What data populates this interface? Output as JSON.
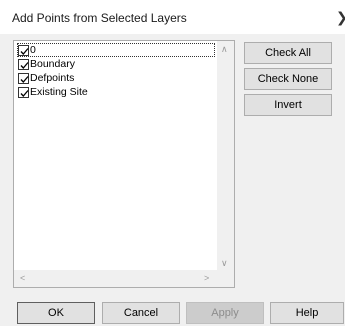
{
  "window": {
    "title": "Add Points from Selected Layers",
    "close_glyph": "❯"
  },
  "layer_list": {
    "items": [
      {
        "label": "0",
        "checked": true
      },
      {
        "label": "Boundary",
        "checked": true
      },
      {
        "label": "Defpoints",
        "checked": true
      },
      {
        "label": "Existing Site",
        "checked": true
      }
    ],
    "scroll_up_glyph": "∧",
    "scroll_down_glyph": "∨",
    "scroll_left_glyph": "<",
    "scroll_right_glyph": ">"
  },
  "side_buttons": {
    "check_all": "Check All",
    "check_none": "Check None",
    "invert": "Invert"
  },
  "footer_buttons": {
    "ok": "OK",
    "cancel": "Cancel",
    "apply": "Apply",
    "help": "Help"
  },
  "colors": {
    "dialog_bg": "#f0f0f0",
    "button_bg": "#e1e1e1",
    "disabled_text": "#8c8c8c"
  }
}
